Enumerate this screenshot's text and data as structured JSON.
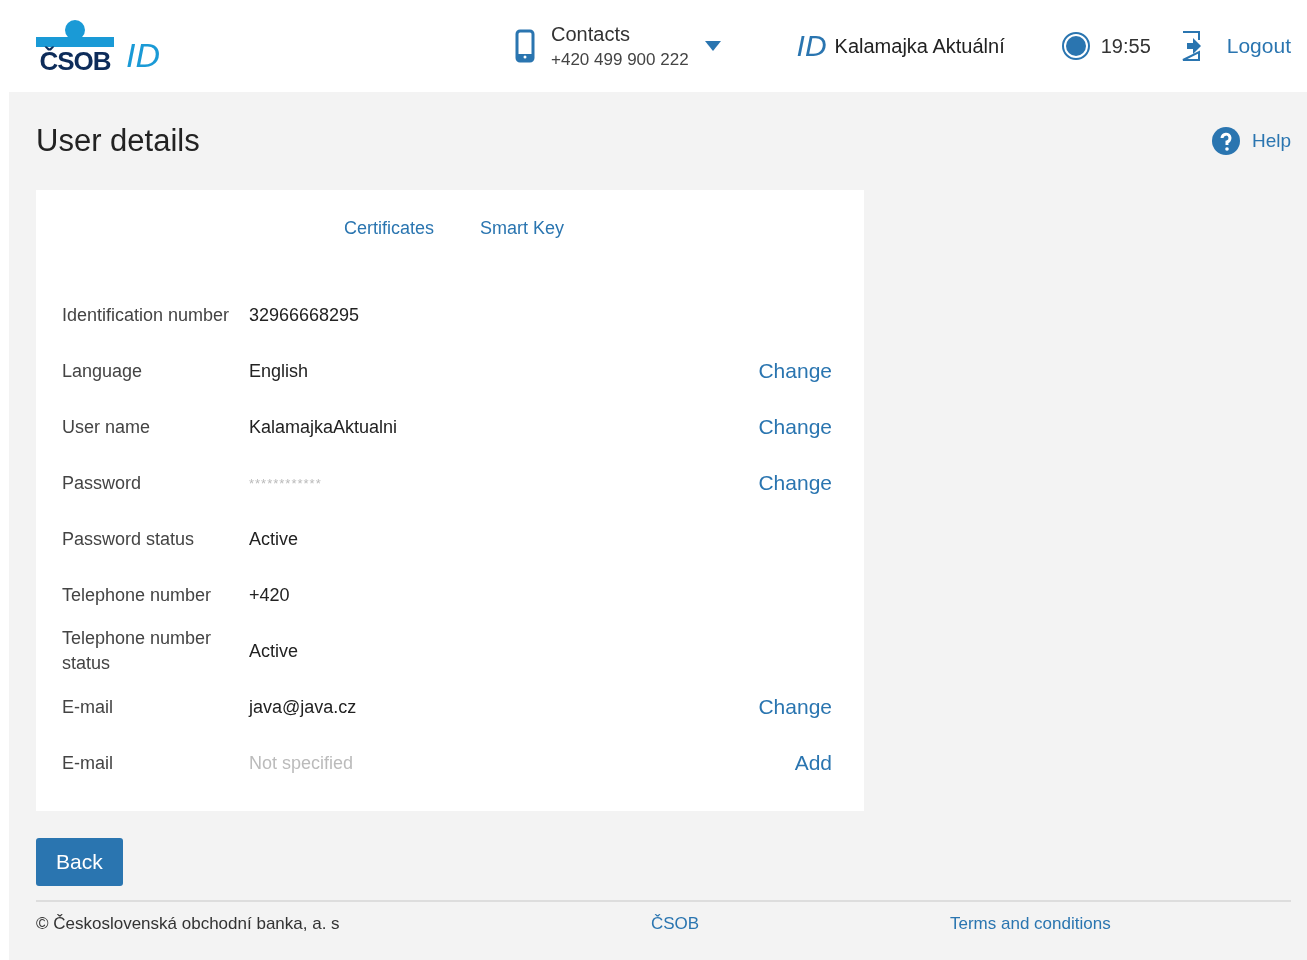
{
  "header": {
    "logo": {
      "brand": "ČSOB",
      "mark": "ID"
    },
    "contacts": {
      "title": "Contacts",
      "phone": "+420 499 900 222"
    },
    "user": {
      "mark": "ID",
      "name": "Kalamajka Aktuální"
    },
    "session_time": "19:55",
    "logout": "Logout"
  },
  "page": {
    "title": "User details",
    "help": "Help"
  },
  "tabs": [
    {
      "label": "Certificates",
      "selected": false
    },
    {
      "label": "Smart Key",
      "selected": false
    }
  ],
  "details": [
    {
      "label": "Identification number",
      "value": "32966668295",
      "kind": "normal"
    },
    {
      "label": "Language",
      "value": "English",
      "kind": "normal",
      "action": "Change"
    },
    {
      "label": "User name",
      "value": "KalamajkaAktualni",
      "kind": "normal",
      "action": "Change"
    },
    {
      "label": "Password",
      "value": "************",
      "kind": "masked",
      "action": "Change"
    },
    {
      "label": "Password status",
      "value": "Active",
      "kind": "normal"
    },
    {
      "label": "Telephone number",
      "value": "+420",
      "kind": "normal"
    },
    {
      "label": "Telephone number status",
      "value": "Active",
      "kind": "normal"
    },
    {
      "label": "E-mail",
      "value": "java@java.cz",
      "kind": "normal",
      "action": "Change"
    },
    {
      "label": "E-mail",
      "value": "Not specified",
      "kind": "empty",
      "action": "Add"
    }
  ],
  "back_button": "Back",
  "footer": {
    "copyright": "© Československá obchodní banka, a. s",
    "links": [
      "ČSOB",
      "Terms and conditions"
    ]
  }
}
